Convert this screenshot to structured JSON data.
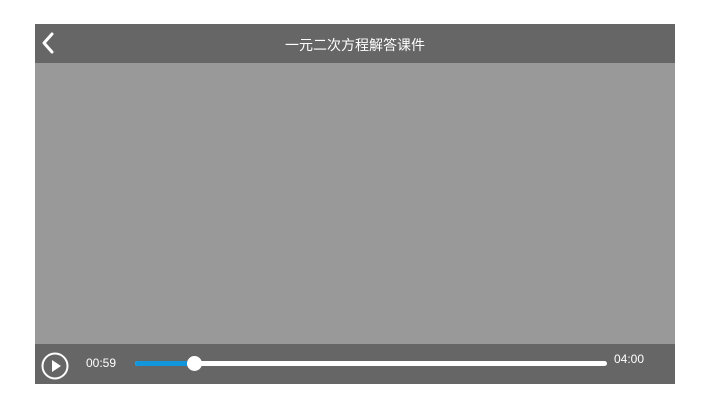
{
  "header": {
    "title": "一元二次方程解答课件",
    "back_icon": "chevron-left-icon"
  },
  "video": {
    "background_color": "#999999"
  },
  "controls": {
    "play_icon": "play-circle-icon",
    "current_time": "00:59",
    "total_time": "04:00",
    "progress_fraction": 0.124,
    "progress_color": "#1296db",
    "bar_color": "#666666"
  }
}
